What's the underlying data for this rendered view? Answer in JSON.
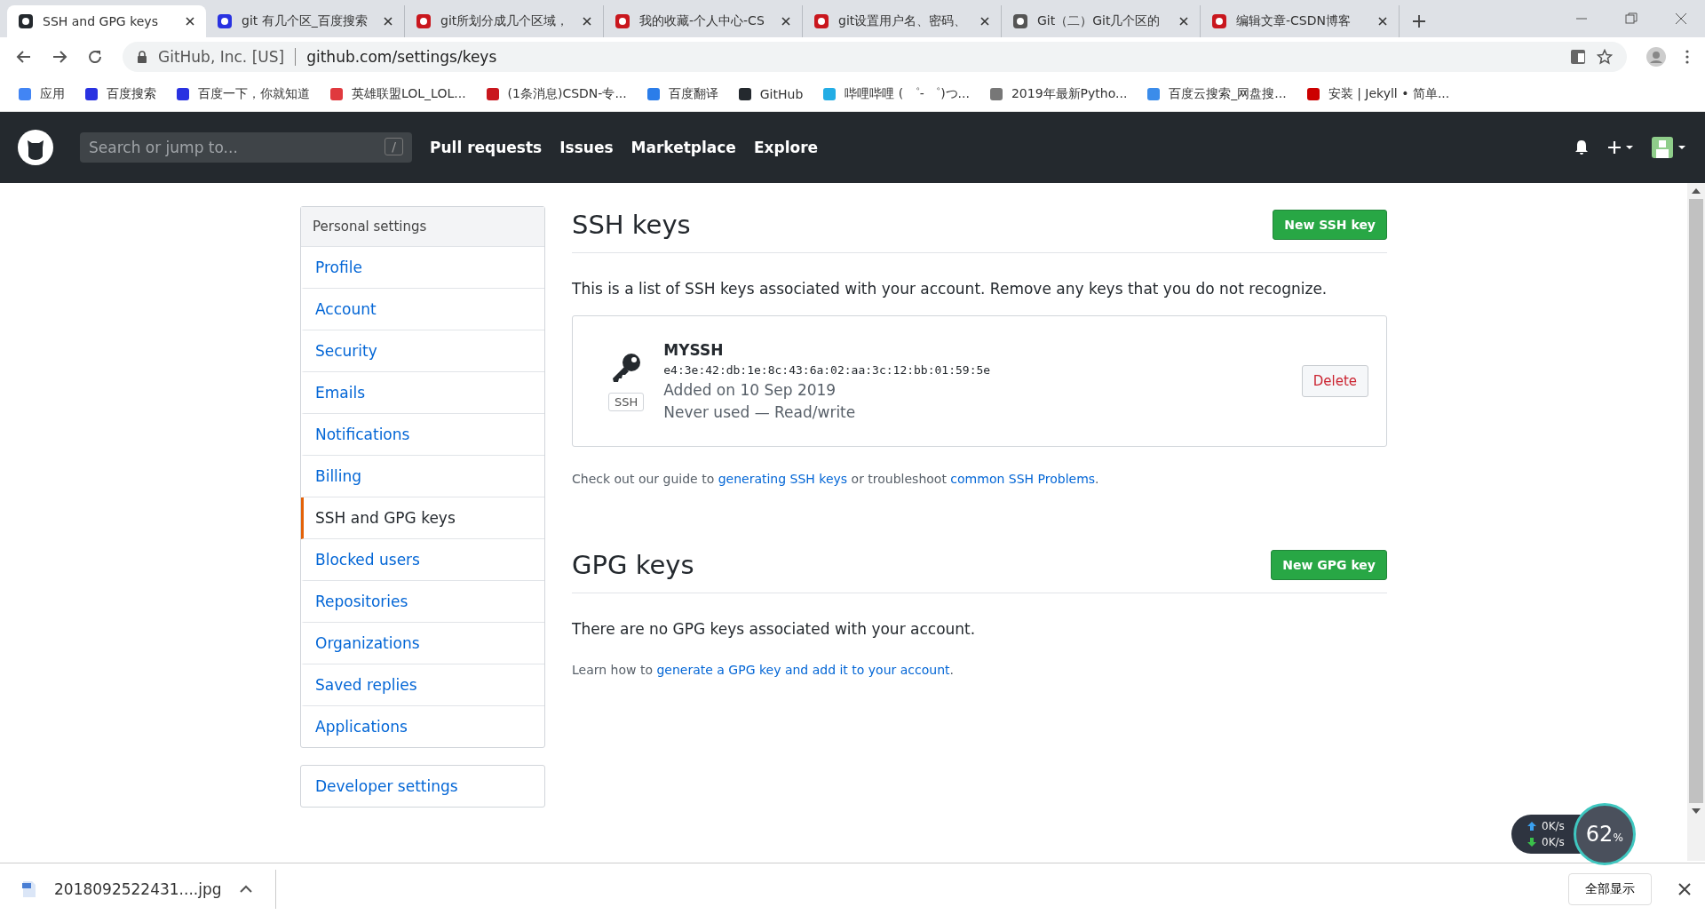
{
  "browser": {
    "tabs": [
      {
        "title": "SSH and GPG keys",
        "selected": true,
        "color": "#24292e"
      },
      {
        "title": "git 有几个区_百度搜索",
        "selected": false,
        "color": "#2932e1"
      },
      {
        "title": "git所划分成几个区域，",
        "selected": false,
        "color": "#c9171e"
      },
      {
        "title": "我的收藏-个人中心-CS",
        "selected": false,
        "color": "#c9171e"
      },
      {
        "title": "git设置用户名、密码、",
        "selected": false,
        "color": "#c9171e"
      },
      {
        "title": "Git（二）Git几个区的",
        "selected": false,
        "color": "#555555"
      },
      {
        "title": "编辑文章-CSDN博客",
        "selected": false,
        "color": "#c9171e"
      }
    ],
    "address": {
      "site_info": "GitHub, Inc. [US]",
      "url": "github.com/settings/keys"
    },
    "bookmarks": [
      {
        "label": "应用",
        "color": "#4285f4"
      },
      {
        "label": "百度搜索",
        "color": "#2932e1"
      },
      {
        "label": "百度一下，你就知道",
        "color": "#2932e1"
      },
      {
        "label": "英雄联盟LOL_LOL...",
        "color": "#e0393e"
      },
      {
        "label": "(1条消息)CSDN-专...",
        "color": "#c9171e"
      },
      {
        "label": "百度翻译",
        "color": "#2b7de9"
      },
      {
        "label": "GitHub",
        "color": "#24292e"
      },
      {
        "label": "哔哩哔哩 ( ゜- ゜)つ...",
        "color": "#23ade5"
      },
      {
        "label": "2019年最新Pytho...",
        "color": "#777777"
      },
      {
        "label": "百度云搜索_网盘搜...",
        "color": "#3b8cea"
      },
      {
        "label": "安装 | Jekyll • 简单...",
        "color": "#cc0000"
      }
    ]
  },
  "header": {
    "search": {
      "placeholder": "Search or jump to...",
      "shortcut": "/"
    },
    "nav": [
      "Pull requests",
      "Issues",
      "Marketplace",
      "Explore"
    ]
  },
  "sidebar": {
    "heading": "Personal settings",
    "items": [
      {
        "label": "Profile",
        "selected": false
      },
      {
        "label": "Account",
        "selected": false
      },
      {
        "label": "Security",
        "selected": false
      },
      {
        "label": "Emails",
        "selected": false
      },
      {
        "label": "Notifications",
        "selected": false
      },
      {
        "label": "Billing",
        "selected": false
      },
      {
        "label": "SSH and GPG keys",
        "selected": true
      },
      {
        "label": "Blocked users",
        "selected": false
      },
      {
        "label": "Repositories",
        "selected": false
      },
      {
        "label": "Organizations",
        "selected": false
      },
      {
        "label": "Saved replies",
        "selected": false
      },
      {
        "label": "Applications",
        "selected": false
      }
    ],
    "developer": "Developer settings"
  },
  "ssh": {
    "title": "SSH keys",
    "button": "New SSH key",
    "intro": "This is a list of SSH keys associated with your account. Remove any keys that you do not recognize.",
    "keys": [
      {
        "name": "MYSSH",
        "fingerprint": "e4:3e:42:db:1e:8c:43:6a:02:aa:3c:12:bb:01:59:5e",
        "added": "Added on 10 Sep 2019",
        "usage": "Never used — Read/write",
        "badge": "SSH",
        "action": "Delete"
      }
    ],
    "guide": [
      {
        "kind": "text",
        "text": "Check out our guide to "
      },
      {
        "kind": "link",
        "text": "generating SSH keys"
      },
      {
        "kind": "text",
        "text": " or troubleshoot "
      },
      {
        "kind": "link",
        "text": "common SSH Problems"
      },
      {
        "kind": "text",
        "text": "."
      }
    ]
  },
  "gpg": {
    "title": "GPG keys",
    "button": "New GPG key",
    "empty": "There are no GPG keys associated with your account.",
    "learn": [
      {
        "kind": "text",
        "text": "Learn how to "
      },
      {
        "kind": "link",
        "text": "generate a GPG key and add it to your account"
      },
      {
        "kind": "text",
        "text": "."
      }
    ]
  },
  "downloads": {
    "file": "2018092522431....jpg",
    "show_all": "全部显示"
  },
  "speed_widget": {
    "upload": "0K/s",
    "download": "0K/s",
    "percent": "62",
    "unit": "%"
  }
}
